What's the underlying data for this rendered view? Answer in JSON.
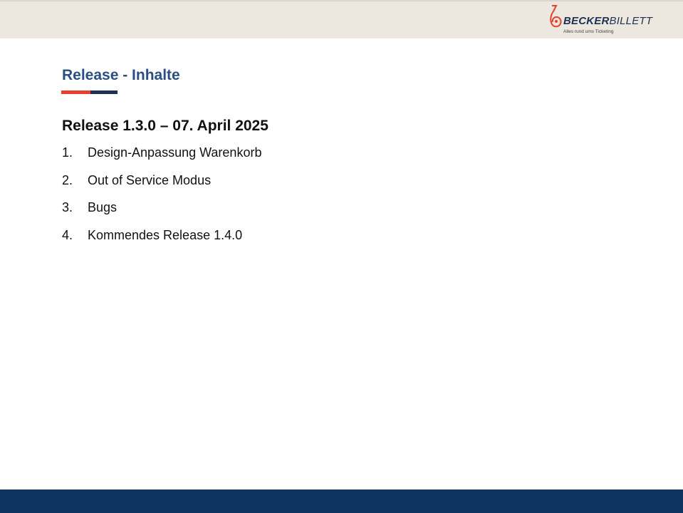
{
  "header": {
    "logo": {
      "name_bold": "BECKER",
      "name_regular": "BILLETT",
      "tagline": "Alles rund ums Ticketing"
    }
  },
  "content": {
    "title": "Release - Inhalte",
    "subtitle": "Release 1.3.0 – 07. April 2025",
    "items": [
      {
        "number": "1.",
        "label": "Design-Anpassung Warenkorb"
      },
      {
        "number": "2.",
        "label": "Out of Service Modus"
      },
      {
        "number": "3.",
        "label": "Bugs"
      },
      {
        "number": "4.",
        "label": "Kommendes Release 1.4.0"
      }
    ]
  },
  "colors": {
    "title_blue": "#2a4f80",
    "accent_red": "#e8402f",
    "brand_navy": "#1e3152",
    "footer_navy": "#0f3360",
    "header_beige": "#ece8df"
  }
}
